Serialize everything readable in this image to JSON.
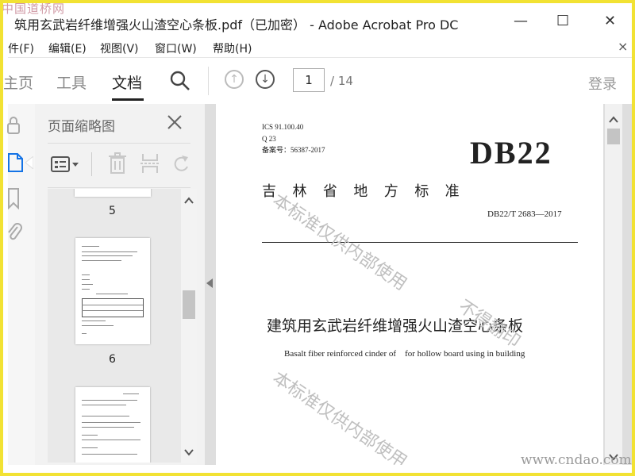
{
  "window": {
    "title": "筑用玄武岩纤维增强火山渣空心条板.pdf（已加密） - Adobe Acrobat Pro DC",
    "minimize": "—",
    "maximize": "☐",
    "close": "✕"
  },
  "menu": {
    "items": [
      {
        "label": "件(F)"
      },
      {
        "label": "编辑(E)"
      },
      {
        "label": "视图(V)"
      },
      {
        "label": "窗口(W)"
      },
      {
        "label": "帮助(H)"
      }
    ],
    "close": "×"
  },
  "toolbar": {
    "tabs": [
      {
        "label": "主页"
      },
      {
        "label": "工具"
      },
      {
        "label": "文档"
      }
    ],
    "page_current": "1",
    "page_total": "/ 14",
    "login": "登录"
  },
  "panel": {
    "title": "页面缩略图",
    "close": "×",
    "page_numbers": [
      "5",
      "6"
    ]
  },
  "document": {
    "ics": "ICS 91.100.40",
    "code": "Q 23",
    "record": "备案号：56387-2017",
    "logo": "DB22",
    "province": "吉  林  省  地  方  标  准",
    "number": "DB22/T 2683—2017",
    "title_cn": "建筑用玄武岩纤维增强火山渣空心条板",
    "title_en": "Basalt fiber reinforced cinder of    for hollow board using in building"
  },
  "watermarks": {
    "internal": "本标准仅供内部使用",
    "no_print": "不得翻印",
    "site_logo": "中国道桥网",
    "site_url": "www.cndao.com"
  },
  "colors": {
    "frame": "#f2e233"
  }
}
